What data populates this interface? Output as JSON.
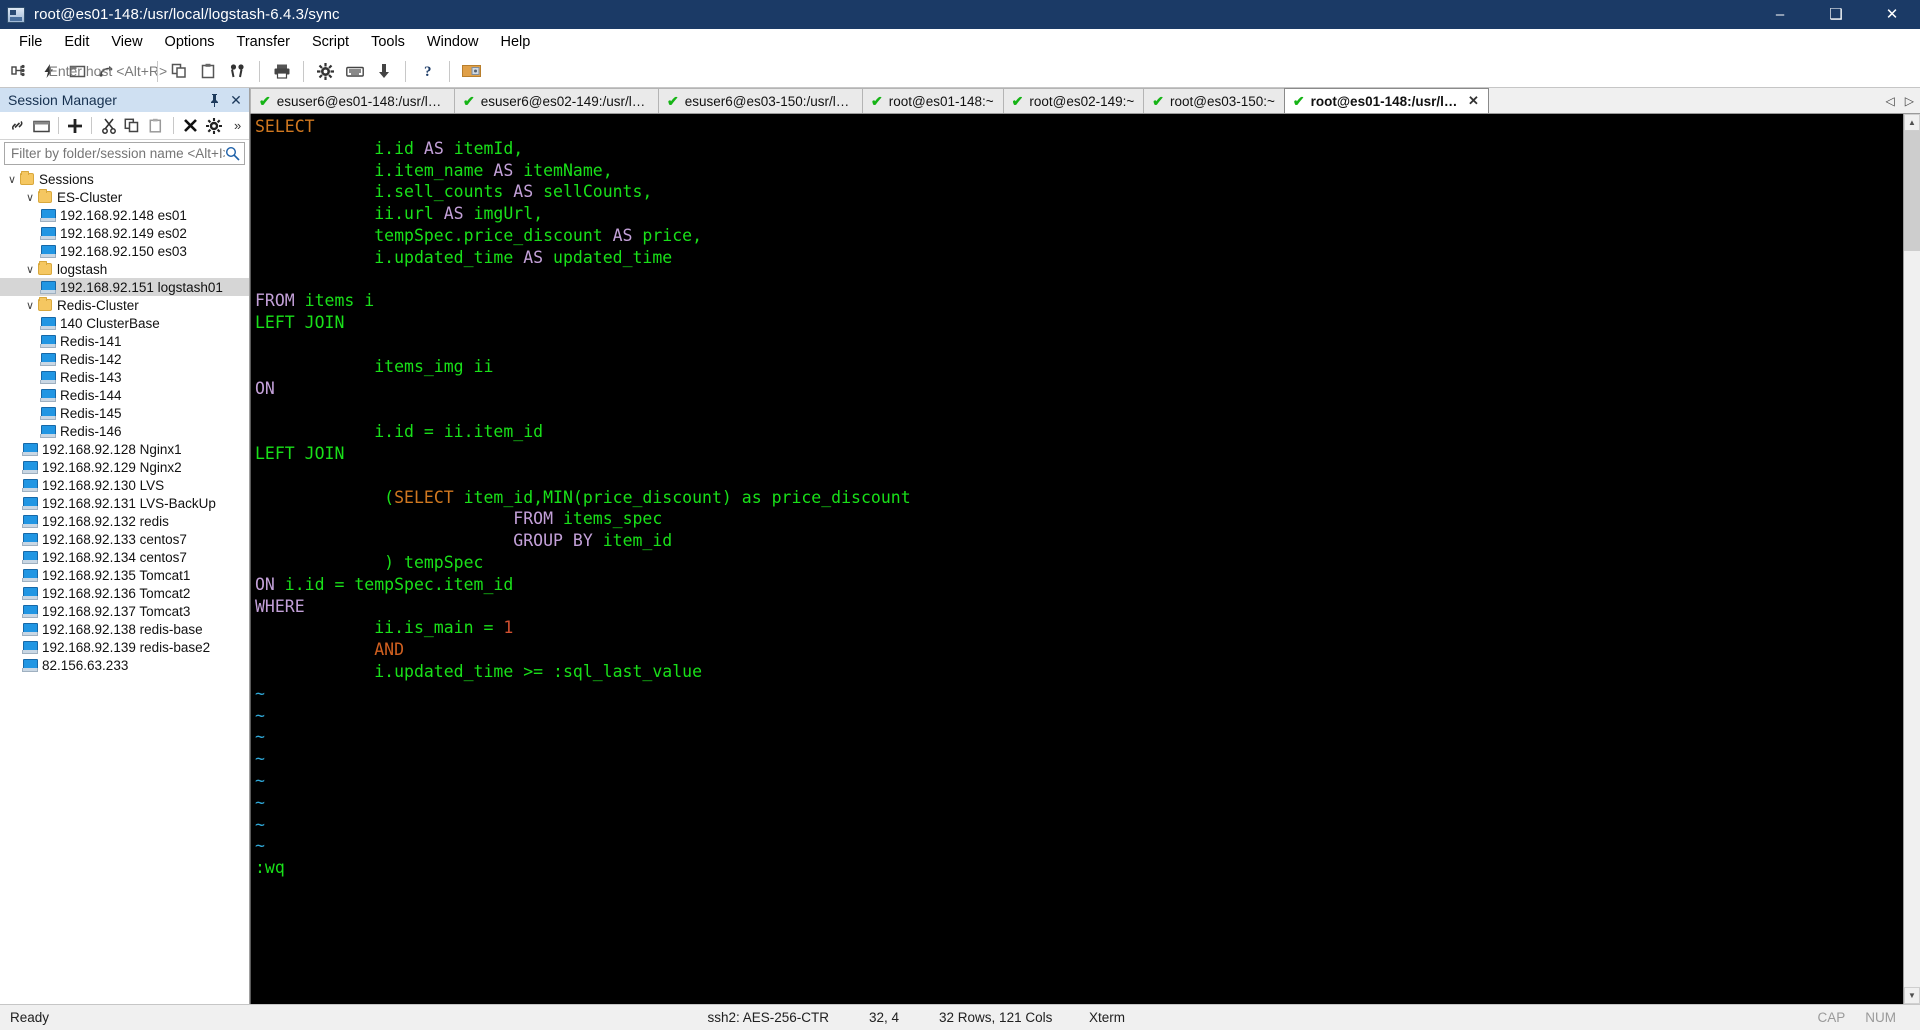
{
  "window": {
    "title": "root@es01-148:/usr/local/logstash-6.4.3/sync",
    "icon": "securecrt-icon",
    "minimize_label": "–",
    "maximize_label": "❑",
    "close_label": "✕"
  },
  "menubar": {
    "items": [
      {
        "label": "File"
      },
      {
        "label": "Edit"
      },
      {
        "label": "View"
      },
      {
        "label": "Options"
      },
      {
        "label": "Transfer"
      },
      {
        "label": "Script"
      },
      {
        "label": "Tools"
      },
      {
        "label": "Window"
      },
      {
        "label": "Help"
      }
    ]
  },
  "toolbar": {
    "host_entry_placeholder": "Enter host <Alt+R>",
    "buttons": [
      {
        "name": "connect-icon"
      },
      {
        "name": "quick-connect-icon"
      },
      {
        "name": "connect-in-tab-icon"
      },
      {
        "name": "reconnect-icon"
      },
      {
        "name": "copy-icon"
      },
      {
        "name": "paste-icon"
      },
      {
        "name": "find-icon"
      },
      {
        "name": "print-icon"
      },
      {
        "name": "session-options-icon"
      },
      {
        "name": "keyboard-icon"
      },
      {
        "name": "transfer-icon"
      },
      {
        "name": "help-icon"
      },
      {
        "name": "sftp-icon"
      }
    ]
  },
  "session_manager": {
    "title": "Session Manager",
    "pin_label": "⎯",
    "close_label": "✕",
    "toolbar_buttons": [
      {
        "name": "connect-session-icon"
      },
      {
        "name": "new-folder-icon"
      },
      {
        "name": "new-session-icon"
      },
      {
        "name": "cut-icon"
      },
      {
        "name": "copy-icon"
      },
      {
        "name": "paste-icon"
      },
      {
        "name": "delete-icon"
      },
      {
        "name": "properties-icon"
      },
      {
        "name": "overflow-icon"
      }
    ],
    "filter_placeholder": "Filter by folder/session name <Alt+I>",
    "tree": [
      {
        "label": "Sessions",
        "type": "folder",
        "depth": 0,
        "expanded": true,
        "selected": false
      },
      {
        "label": "ES-Cluster",
        "type": "folder",
        "depth": 1,
        "expanded": true,
        "selected": false
      },
      {
        "label": "192.168.92.148 es01",
        "type": "host",
        "depth": 2,
        "selected": false
      },
      {
        "label": "192.168.92.149 es02",
        "type": "host",
        "depth": 2,
        "selected": false
      },
      {
        "label": "192.168.92.150 es03",
        "type": "host",
        "depth": 2,
        "selected": false
      },
      {
        "label": "logstash",
        "type": "folder",
        "depth": 1,
        "expanded": true,
        "selected": false
      },
      {
        "label": "192.168.92.151 logstash01",
        "type": "host",
        "depth": 2,
        "selected": true
      },
      {
        "label": "Redis-Cluster",
        "type": "folder",
        "depth": 1,
        "expanded": true,
        "selected": false
      },
      {
        "label": "140 ClusterBase",
        "type": "host",
        "depth": 2,
        "selected": false
      },
      {
        "label": "Redis-141",
        "type": "host",
        "depth": 2,
        "selected": false
      },
      {
        "label": "Redis-142",
        "type": "host",
        "depth": 2,
        "selected": false
      },
      {
        "label": "Redis-143",
        "type": "host",
        "depth": 2,
        "selected": false
      },
      {
        "label": "Redis-144",
        "type": "host",
        "depth": 2,
        "selected": false
      },
      {
        "label": "Redis-145",
        "type": "host",
        "depth": 2,
        "selected": false
      },
      {
        "label": "Redis-146",
        "type": "host",
        "depth": 2,
        "selected": false
      },
      {
        "label": "192.168.92.128 Nginx1",
        "type": "host",
        "depth": 1,
        "selected": false
      },
      {
        "label": "192.168.92.129 Nginx2",
        "type": "host",
        "depth": 1,
        "selected": false
      },
      {
        "label": "192.168.92.130 LVS",
        "type": "host",
        "depth": 1,
        "selected": false
      },
      {
        "label": "192.168.92.131 LVS-BackUp",
        "type": "host",
        "depth": 1,
        "selected": false
      },
      {
        "label": "192.168.92.132 redis",
        "type": "host",
        "depth": 1,
        "selected": false
      },
      {
        "label": "192.168.92.133 centos7",
        "type": "host",
        "depth": 1,
        "selected": false
      },
      {
        "label": "192.168.92.134 centos7",
        "type": "host",
        "depth": 1,
        "selected": false
      },
      {
        "label": "192.168.92.135 Tomcat1",
        "type": "host",
        "depth": 1,
        "selected": false
      },
      {
        "label": "192.168.92.136 Tomcat2",
        "type": "host",
        "depth": 1,
        "selected": false
      },
      {
        "label": "192.168.92.137 Tomcat3",
        "type": "host",
        "depth": 1,
        "selected": false
      },
      {
        "label": "192.168.92.138 redis-base",
        "type": "host",
        "depth": 1,
        "selected": false
      },
      {
        "label": "192.168.92.139 redis-base2",
        "type": "host",
        "depth": 1,
        "selected": false
      },
      {
        "label": "82.156.63.233",
        "type": "host",
        "depth": 1,
        "selected": false
      }
    ]
  },
  "tabs": {
    "items": [
      {
        "label": "esuser6@es01-148:/usr/local...",
        "status": "connected",
        "active": false
      },
      {
        "label": "esuser6@es02-149:/usr/local...",
        "status": "connected",
        "active": false
      },
      {
        "label": "esuser6@es03-150:/usr/local...",
        "status": "connected",
        "active": false
      },
      {
        "label": "root@es01-148:~",
        "status": "connected",
        "active": false
      },
      {
        "label": "root@es02-149:~",
        "status": "connected",
        "active": false
      },
      {
        "label": "root@es03-150:~",
        "status": "connected",
        "active": false
      },
      {
        "label": "root@es01-148:/usr/loca...",
        "status": "connected",
        "active": true
      }
    ],
    "check_glyph": "✔",
    "close_glyph": "✕",
    "nav_prev": "◁",
    "nav_next": "▷"
  },
  "terminal": {
    "lines": [
      [
        {
          "t": "SELECT",
          "c": "sel"
        }
      ],
      [
        {
          "t": "            i.id ",
          "c": "grn"
        },
        {
          "t": "AS",
          "c": "kw"
        },
        {
          "t": " itemId,",
          "c": "grn"
        }
      ],
      [
        {
          "t": "            i.item_name ",
          "c": "grn"
        },
        {
          "t": "AS",
          "c": "kw"
        },
        {
          "t": " itemName,",
          "c": "grn"
        }
      ],
      [
        {
          "t": "            i.sell_counts ",
          "c": "grn"
        },
        {
          "t": "AS",
          "c": "kw"
        },
        {
          "t": " sellCounts,",
          "c": "grn"
        }
      ],
      [
        {
          "t": "            ii.url ",
          "c": "grn"
        },
        {
          "t": "AS",
          "c": "kw"
        },
        {
          "t": " imgUrl,",
          "c": "grn"
        }
      ],
      [
        {
          "t": "            tempSpec.price_discount ",
          "c": "grn"
        },
        {
          "t": "AS",
          "c": "kw"
        },
        {
          "t": " price,",
          "c": "grn"
        }
      ],
      [
        {
          "t": "            i.updated_time ",
          "c": "grn"
        },
        {
          "t": "AS",
          "c": "kw"
        },
        {
          "t": " updated_time",
          "c": "grn"
        }
      ],
      [
        {
          "t": "",
          "c": "grn"
        }
      ],
      [
        {
          "t": "FROM",
          "c": "kw"
        },
        {
          "t": " items i",
          "c": "grn"
        }
      ],
      [
        {
          "t": "LEFT JOIN",
          "c": "grn"
        }
      ],
      [
        {
          "t": "",
          "c": "grn"
        }
      ],
      [
        {
          "t": "            items_img ii",
          "c": "grn"
        }
      ],
      [
        {
          "t": "ON",
          "c": "kw"
        }
      ],
      [
        {
          "t": "",
          "c": "grn"
        }
      ],
      [
        {
          "t": "            i.id = ii.item_id",
          "c": "grn"
        }
      ],
      [
        {
          "t": "LEFT JOIN",
          "c": "grn"
        }
      ],
      [
        {
          "t": "",
          "c": "grn"
        }
      ],
      [
        {
          "t": "             (",
          "c": "grn"
        },
        {
          "t": "SELECT",
          "c": "sel"
        },
        {
          "t": " item_id,MIN(price_discount) as price_discount",
          "c": "grn"
        }
      ],
      [
        {
          "t": "                          ",
          "c": "grn"
        },
        {
          "t": "FROM",
          "c": "kw"
        },
        {
          "t": " items_spec",
          "c": "grn"
        }
      ],
      [
        {
          "t": "                          ",
          "c": "grn"
        },
        {
          "t": "GROUP BY",
          "c": "kw"
        },
        {
          "t": " item_id",
          "c": "grn"
        }
      ],
      [
        {
          "t": "             ) tempSpec",
          "c": "grn"
        }
      ],
      [
        {
          "t": "ON",
          "c": "kw"
        },
        {
          "t": " i.id = tempSpec.item_id",
          "c": "grn"
        }
      ],
      [
        {
          "t": "WHERE",
          "c": "kw"
        }
      ],
      [
        {
          "t": "            ii.is_main = ",
          "c": "grn"
        },
        {
          "t": "1",
          "c": "num"
        }
      ],
      [
        {
          "t": "            AND",
          "c": "org"
        }
      ],
      [
        {
          "t": "            i.updated_time >= :sql_last_value",
          "c": "grn"
        }
      ],
      [
        {
          "t": "~",
          "c": "tilde"
        }
      ],
      [
        {
          "t": "~",
          "c": "tilde"
        }
      ],
      [
        {
          "t": "~",
          "c": "tilde"
        }
      ],
      [
        {
          "t": "~",
          "c": "tilde"
        }
      ],
      [
        {
          "t": "~",
          "c": "tilde"
        }
      ],
      [
        {
          "t": "~",
          "c": "tilde"
        }
      ],
      [
        {
          "t": "~",
          "c": "tilde"
        }
      ],
      [
        {
          "t": "~",
          "c": "tilde"
        }
      ],
      [
        {
          "t": ":wq",
          "c": "grn"
        }
      ]
    ]
  },
  "statusbar": {
    "ready": "Ready",
    "encryption": "ssh2: AES-256-CTR",
    "cursor": "32,  4",
    "size": "32 Rows, 121 Cols",
    "emulation": "Xterm",
    "caps": "CAP",
    "num": "NUM"
  }
}
